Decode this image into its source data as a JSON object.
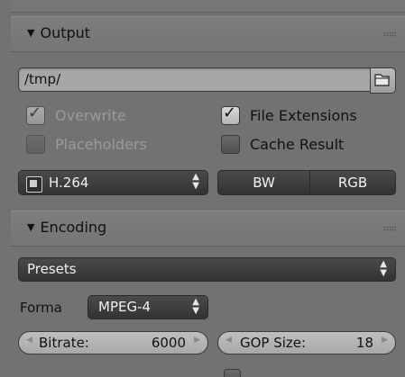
{
  "output_panel": {
    "title": "Output",
    "path_value": "/tmp/",
    "overwrite_label": "Overwrite",
    "overwrite_checked": true,
    "file_extensions_label": "File Extensions",
    "file_extensions_checked": true,
    "placeholders_label": "Placeholders",
    "placeholders_checked": false,
    "cache_result_label": "Cache Result",
    "cache_result_checked": false,
    "file_format_value": "H.264",
    "color_modes": [
      "BW",
      "RGB"
    ]
  },
  "encoding_panel": {
    "title": "Encoding",
    "presets_label": "Presets",
    "format_label": "Forma",
    "format_value": "MPEG-4",
    "bitrate_label": "Bitrate:",
    "bitrate_value": "6000",
    "gop_size_label": "GOP Size:",
    "gop_size_value": "18"
  },
  "icons": {
    "collapse": "triangle-down-icon",
    "drag_grip": "grip-dots-icon",
    "folder": "folder-icon",
    "film": "film-icon",
    "checkmark": "checkmark-icon",
    "spinner": "up-down-arrows-icon"
  },
  "colors": {
    "panel_bg": "#727272",
    "dark_widget": "#3a3a3a",
    "field_bg": "#a6a6a6",
    "disabled_text": "#9a9a9a"
  }
}
